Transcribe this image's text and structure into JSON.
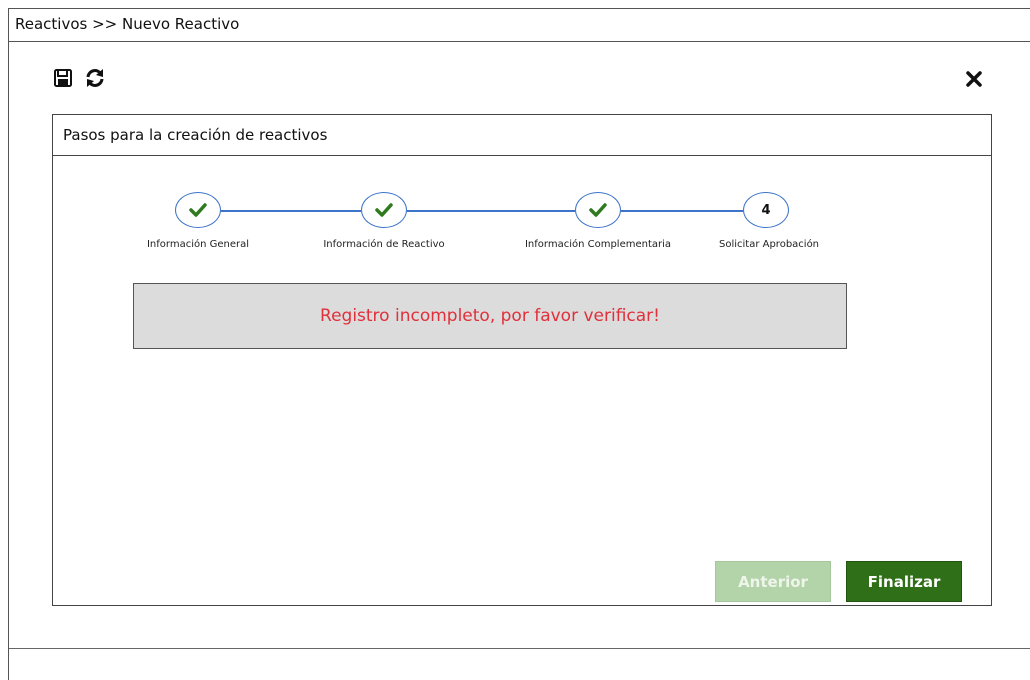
{
  "breadcrumb": "Reactivos >> Nuevo Reactivo",
  "toolbar": {
    "save_icon": "floppy-disk-icon",
    "refresh_icon": "refresh-icon",
    "close_icon": "close-icon"
  },
  "panel": {
    "title": "Pasos para la creación de reactivos"
  },
  "steps": [
    {
      "label": "Información General",
      "state": "complete"
    },
    {
      "label": "Información de Reactivo",
      "state": "complete"
    },
    {
      "label": "Información Complementaria",
      "state": "complete"
    },
    {
      "label": "Solicitar Aprobación",
      "state": "current",
      "number": "4"
    }
  ],
  "alert": {
    "message": "Registro incompleto, por favor verificar!"
  },
  "buttons": {
    "previous": "Anterior",
    "finish": "Finalizar"
  },
  "colors": {
    "step_line": "#3d74c9",
    "check": "#2f7a1f",
    "alert_text": "#e0303a",
    "finish_button": "#2f6f17",
    "previous_button_disabled": "#b3d3a8"
  }
}
